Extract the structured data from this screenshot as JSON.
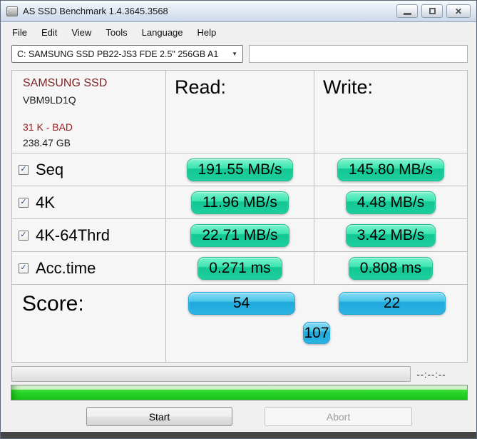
{
  "window": {
    "title": "AS SSD Benchmark 1.4.3645.3568"
  },
  "menu": {
    "items": [
      "File",
      "Edit",
      "View",
      "Tools",
      "Language",
      "Help"
    ]
  },
  "toolbar": {
    "drive_select": "C: SAMSUNG SSD PB22-JS3 FDE 2.5\" 256GB A1",
    "textbox_value": ""
  },
  "info": {
    "model": "SAMSUNG SSD",
    "firmware": "VBM9LD1Q",
    "alignment": "31 K - BAD",
    "capacity": "238.47 GB"
  },
  "table": {
    "read_header": "Read:",
    "write_header": "Write:",
    "rows": [
      {
        "label": "Seq",
        "checked": true,
        "read": "191.55 MB/s",
        "write": "145.80 MB/s"
      },
      {
        "label": "4K",
        "checked": true,
        "read": "11.96 MB/s",
        "write": "4.48 MB/s"
      },
      {
        "label": "4K-64Thrd",
        "checked": true,
        "read": "22.71 MB/s",
        "write": "3.42 MB/s"
      },
      {
        "label": "Acc.time",
        "checked": true,
        "read": "0.271 ms",
        "write": "0.808 ms"
      }
    ]
  },
  "score": {
    "label": "Score:",
    "read_score": "54",
    "write_score": "22",
    "total_score": "107"
  },
  "status": {
    "time": "--:--:--"
  },
  "buttons": {
    "start": "Start",
    "abort": "Abort"
  },
  "colors": {
    "value_pill_green_top": "#7DF3CC",
    "value_pill_green_bottom": "#1DCF9E",
    "score_pill_blue_top": "#8BDEF5",
    "score_pill_blue_bottom": "#2BB3E2",
    "progress_green": "#21CF21",
    "bad_text": "#9E1B1B"
  },
  "glyphs": {
    "check": "✓",
    "dropdown_arrow": "▼",
    "close": "✕"
  }
}
